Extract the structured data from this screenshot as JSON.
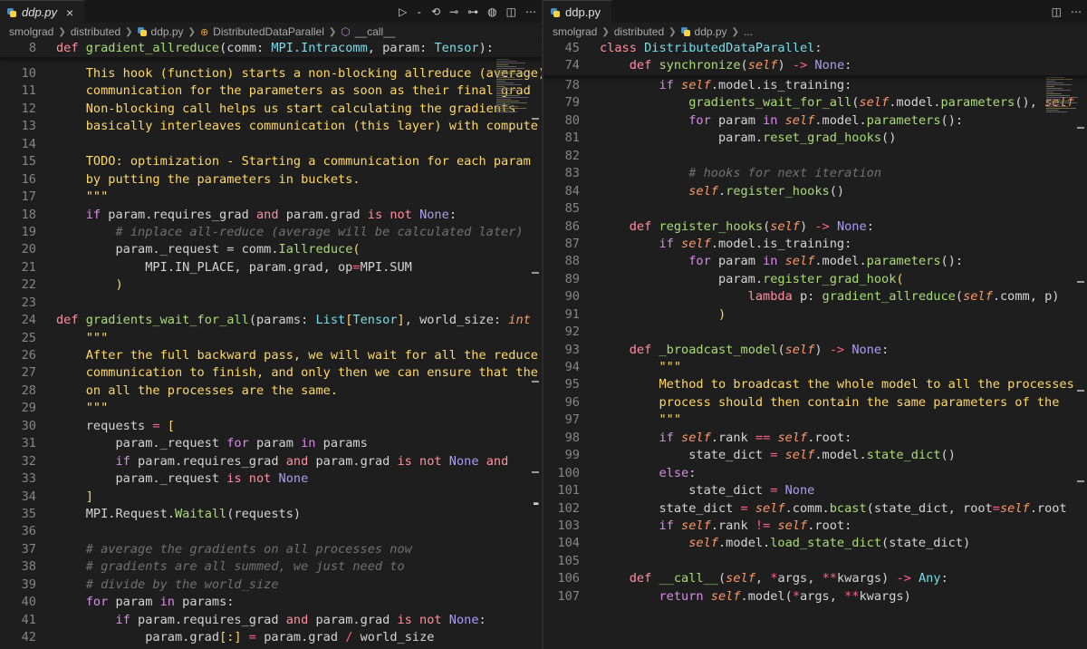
{
  "left": {
    "tab": {
      "title": "ddp.py",
      "close": "×"
    },
    "breadcrumb": [
      "smolgrad",
      "distributed",
      "ddp.py",
      "DistributedDataParallel",
      "__call__"
    ],
    "sticky": [
      {
        "num": "8",
        "tokens": [
          [
            "kw",
            "def "
          ],
          [
            "fn",
            "gradient_allreduce"
          ],
          [
            "",
            "(comm: "
          ],
          [
            "ty",
            "MPI.Intracomm"
          ],
          [
            "",
            ", param: "
          ],
          [
            "ty",
            "Tensor"
          ],
          [
            "",
            "):"
          ]
        ]
      }
    ],
    "lines": [
      {
        "num": "10",
        "tokens": [
          [
            "str",
            "    This hook (function) starts a non-blocking allreduce (average)"
          ]
        ]
      },
      {
        "num": "11",
        "tokens": [
          [
            "str",
            "    communication for the parameters as soon as their final grad"
          ]
        ]
      },
      {
        "num": "12",
        "tokens": [
          [
            "str",
            "    Non-blocking call helps us start calculating the gradients"
          ]
        ]
      },
      {
        "num": "13",
        "tokens": [
          [
            "str",
            "    basically interleaves communication (this layer) with compute"
          ]
        ]
      },
      {
        "num": "14",
        "tokens": []
      },
      {
        "num": "15",
        "tokens": [
          [
            "str",
            "    TODO: optimization - Starting a communication for each param"
          ]
        ]
      },
      {
        "num": "16",
        "tokens": [
          [
            "str",
            "    by putting the parameters in buckets."
          ]
        ]
      },
      {
        "num": "17",
        "tokens": [
          [
            "str",
            "    \"\"\""
          ]
        ]
      },
      {
        "num": "18",
        "tokens": [
          [
            "ctl",
            "    if "
          ],
          [
            "",
            "param.requires_grad "
          ],
          [
            "kw",
            "and "
          ],
          [
            "",
            "param.grad "
          ],
          [
            "kw",
            "is not "
          ],
          [
            "con",
            "None"
          ],
          [
            "",
            ":"
          ]
        ]
      },
      {
        "num": "19",
        "tokens": [
          [
            "com",
            "        # inplace all-reduce (average will be calculated later)"
          ]
        ]
      },
      {
        "num": "20",
        "tokens": [
          [
            "",
            "        param._request = comm."
          ],
          [
            "fn",
            "Iallreduce"
          ],
          [
            "br",
            "("
          ]
        ]
      },
      {
        "num": "21",
        "tokens": [
          [
            "",
            "            MPI.IN_PLACE, param.grad, op"
          ],
          [
            "op",
            "="
          ],
          [
            "",
            "MPI.SUM"
          ]
        ]
      },
      {
        "num": "22",
        "tokens": [
          [
            "br",
            "        )"
          ]
        ]
      },
      {
        "num": "23",
        "tokens": []
      },
      {
        "num": "24",
        "tokens": [
          [
            "kw",
            "def "
          ],
          [
            "fn",
            "gradients_wait_for_all"
          ],
          [
            "",
            "(params: "
          ],
          [
            "ty",
            "List"
          ],
          [
            "br",
            "["
          ],
          [
            "ty",
            "Tensor"
          ],
          [
            "br",
            "]"
          ],
          [
            "",
            ", world_size: "
          ],
          [
            "self",
            "int"
          ]
        ]
      },
      {
        "num": "25",
        "tokens": [
          [
            "str",
            "    \"\"\""
          ]
        ]
      },
      {
        "num": "26",
        "tokens": [
          [
            "str",
            "    After the full backward pass, we will wait for all the reduce"
          ]
        ]
      },
      {
        "num": "27",
        "tokens": [
          [
            "str",
            "    communication to finish, and only then we can ensure that the"
          ]
        ]
      },
      {
        "num": "28",
        "tokens": [
          [
            "str",
            "    on all the processes are the same."
          ]
        ]
      },
      {
        "num": "29",
        "tokens": [
          [
            "str",
            "    \"\"\""
          ]
        ]
      },
      {
        "num": "30",
        "tokens": [
          [
            "",
            "    requests "
          ],
          [
            "op",
            "= "
          ],
          [
            "br",
            "["
          ]
        ]
      },
      {
        "num": "31",
        "tokens": [
          [
            "",
            "        param._request "
          ],
          [
            "ctl",
            "for "
          ],
          [
            "",
            "param "
          ],
          [
            "ctl",
            "in "
          ],
          [
            "",
            "params"
          ]
        ]
      },
      {
        "num": "32",
        "tokens": [
          [
            "ctl",
            "        if "
          ],
          [
            "",
            "param.requires_grad "
          ],
          [
            "kw",
            "and "
          ],
          [
            "",
            "param.grad "
          ],
          [
            "kw",
            "is not "
          ],
          [
            "con",
            "None "
          ],
          [
            "kw",
            "and"
          ]
        ]
      },
      {
        "num": "33",
        "tokens": [
          [
            "",
            "        param._request "
          ],
          [
            "kw",
            "is not "
          ],
          [
            "con",
            "None"
          ]
        ]
      },
      {
        "num": "34",
        "tokens": [
          [
            "br",
            "    ]"
          ]
        ]
      },
      {
        "num": "35",
        "tokens": [
          [
            "",
            "    MPI.Request."
          ],
          [
            "fn",
            "Waitall"
          ],
          [
            "",
            "(requests)"
          ]
        ]
      },
      {
        "num": "36",
        "tokens": []
      },
      {
        "num": "37",
        "tokens": [
          [
            "com",
            "    # average the gradients on all processes now"
          ]
        ]
      },
      {
        "num": "38",
        "tokens": [
          [
            "com",
            "    # gradients are all summed, we just need to"
          ]
        ]
      },
      {
        "num": "39",
        "tokens": [
          [
            "com",
            "    # divide by the world_size"
          ]
        ]
      },
      {
        "num": "40",
        "tokens": [
          [
            "ctl",
            "    for "
          ],
          [
            "",
            "param "
          ],
          [
            "ctl",
            "in "
          ],
          [
            "",
            "params:"
          ]
        ]
      },
      {
        "num": "41",
        "tokens": [
          [
            "ctl",
            "        if "
          ],
          [
            "",
            "param.requires_grad "
          ],
          [
            "kw",
            "and "
          ],
          [
            "",
            "param.grad "
          ],
          [
            "kw",
            "is not "
          ],
          [
            "con",
            "None"
          ],
          [
            "",
            ":"
          ]
        ]
      },
      {
        "num": "42",
        "tokens": [
          [
            "",
            "            param.grad"
          ],
          [
            "br",
            "[:]"
          ],
          [
            "op",
            " = "
          ],
          [
            "",
            "param.grad "
          ],
          [
            "op",
            "/ "
          ],
          [
            "",
            "world_size"
          ]
        ]
      }
    ]
  },
  "right": {
    "tab": {
      "title": "ddp.py"
    },
    "breadcrumb": [
      "smolgrad",
      "distributed",
      "ddp.py",
      "..."
    ],
    "sticky": [
      {
        "num": "45",
        "tokens": [
          [
            "kw",
            "class "
          ],
          [
            "ty",
            "DistributedDataParallel"
          ],
          [
            "",
            ":"
          ]
        ]
      },
      {
        "num": "74",
        "tokens": [
          [
            "kw",
            "    def "
          ],
          [
            "fn",
            "synchronize"
          ],
          [
            "",
            "("
          ],
          [
            "self",
            "self"
          ],
          [
            "",
            ") "
          ],
          [
            "op",
            "-> "
          ],
          [
            "con",
            "None"
          ],
          [
            "",
            ":"
          ]
        ]
      }
    ],
    "lines": [
      {
        "num": "78",
        "tokens": [
          [
            "ctl",
            "        if "
          ],
          [
            "self",
            "self"
          ],
          [
            "",
            ".model.is_training:"
          ]
        ]
      },
      {
        "num": "79",
        "tokens": [
          [
            "fn",
            "            gradients_wait_for_all"
          ],
          [
            "",
            "("
          ],
          [
            "self",
            "self"
          ],
          [
            "",
            ".model."
          ],
          [
            "fn",
            "parameters"
          ],
          [
            "",
            "(), "
          ],
          [
            "self",
            "self"
          ]
        ]
      },
      {
        "num": "80",
        "tokens": [
          [
            "ctl",
            "            for "
          ],
          [
            "",
            "param "
          ],
          [
            "ctl",
            "in "
          ],
          [
            "self",
            "self"
          ],
          [
            "",
            ".model."
          ],
          [
            "fn",
            "parameters"
          ],
          [
            "",
            "():"
          ]
        ]
      },
      {
        "num": "81",
        "tokens": [
          [
            "",
            "                param."
          ],
          [
            "fn",
            "reset_grad_hooks"
          ],
          [
            "",
            "()"
          ]
        ]
      },
      {
        "num": "82",
        "tokens": []
      },
      {
        "num": "83",
        "tokens": [
          [
            "com",
            "            # hooks for next iteration"
          ]
        ]
      },
      {
        "num": "84",
        "tokens": [
          [
            "self",
            "            self"
          ],
          [
            "",
            "."
          ],
          [
            "fn",
            "register_hooks"
          ],
          [
            "",
            "()"
          ]
        ]
      },
      {
        "num": "85",
        "tokens": []
      },
      {
        "num": "86",
        "tokens": [
          [
            "kw",
            "    def "
          ],
          [
            "fn",
            "register_hooks"
          ],
          [
            "",
            "("
          ],
          [
            "self",
            "self"
          ],
          [
            "",
            ") "
          ],
          [
            "op",
            "-> "
          ],
          [
            "con",
            "None"
          ],
          [
            "",
            ":"
          ]
        ]
      },
      {
        "num": "87",
        "tokens": [
          [
            "ctl",
            "        if "
          ],
          [
            "self",
            "self"
          ],
          [
            "",
            ".model.is_training:"
          ]
        ]
      },
      {
        "num": "88",
        "tokens": [
          [
            "ctl",
            "            for "
          ],
          [
            "",
            "param "
          ],
          [
            "ctl",
            "in "
          ],
          [
            "self",
            "self"
          ],
          [
            "",
            ".model."
          ],
          [
            "fn",
            "parameters"
          ],
          [
            "",
            "():"
          ]
        ]
      },
      {
        "num": "89",
        "tokens": [
          [
            "",
            "                param."
          ],
          [
            "fn",
            "register_grad_hook"
          ],
          [
            "br",
            "("
          ]
        ]
      },
      {
        "num": "90",
        "tokens": [
          [
            "kw",
            "                    lambda "
          ],
          [
            "",
            "p: "
          ],
          [
            "fn",
            "gradient_allreduce"
          ],
          [
            "",
            "("
          ],
          [
            "self",
            "self"
          ],
          [
            "",
            ".comm, p)"
          ]
        ]
      },
      {
        "num": "91",
        "tokens": [
          [
            "br",
            "                )"
          ]
        ]
      },
      {
        "num": "92",
        "tokens": []
      },
      {
        "num": "93",
        "tokens": [
          [
            "kw",
            "    def "
          ],
          [
            "fn",
            "_broadcast_model"
          ],
          [
            "",
            "("
          ],
          [
            "self",
            "self"
          ],
          [
            "",
            ") "
          ],
          [
            "op",
            "-> "
          ],
          [
            "con",
            "None"
          ],
          [
            "",
            ":"
          ]
        ]
      },
      {
        "num": "94",
        "tokens": [
          [
            "str",
            "        \"\"\""
          ]
        ]
      },
      {
        "num": "95",
        "tokens": [
          [
            "str",
            "        Method to broadcast the whole model to all the processes"
          ]
        ]
      },
      {
        "num": "96",
        "tokens": [
          [
            "str",
            "        process should then contain the same parameters of the"
          ]
        ]
      },
      {
        "num": "97",
        "tokens": [
          [
            "str",
            "        \"\"\""
          ]
        ]
      },
      {
        "num": "98",
        "tokens": [
          [
            "ctl",
            "        if "
          ],
          [
            "self",
            "self"
          ],
          [
            "",
            ".rank "
          ],
          [
            "op",
            "== "
          ],
          [
            "self",
            "self"
          ],
          [
            "",
            ".root:"
          ]
        ]
      },
      {
        "num": "99",
        "tokens": [
          [
            "",
            "            state_dict "
          ],
          [
            "op",
            "= "
          ],
          [
            "self",
            "self"
          ],
          [
            "",
            ".model."
          ],
          [
            "fn",
            "state_dict"
          ],
          [
            "",
            "()"
          ]
        ]
      },
      {
        "num": "100",
        "tokens": [
          [
            "ctl",
            "        else"
          ],
          [
            "",
            ":"
          ]
        ]
      },
      {
        "num": "101",
        "tokens": [
          [
            "",
            "            state_dict "
          ],
          [
            "op",
            "= "
          ],
          [
            "con",
            "None"
          ]
        ]
      },
      {
        "num": "102",
        "tokens": [
          [
            "",
            "        state_dict "
          ],
          [
            "op",
            "= "
          ],
          [
            "self",
            "self"
          ],
          [
            "",
            ".comm."
          ],
          [
            "fn",
            "bcast"
          ],
          [
            "",
            "(state_dict, root"
          ],
          [
            "op",
            "="
          ],
          [
            "self",
            "self"
          ],
          [
            "",
            ".root"
          ]
        ]
      },
      {
        "num": "103",
        "tokens": [
          [
            "ctl",
            "        if "
          ],
          [
            "self",
            "self"
          ],
          [
            "",
            ".rank "
          ],
          [
            "op",
            "!= "
          ],
          [
            "self",
            "self"
          ],
          [
            "",
            ".root:"
          ]
        ]
      },
      {
        "num": "104",
        "tokens": [
          [
            "self",
            "            self"
          ],
          [
            "",
            ".model."
          ],
          [
            "fn",
            "load_state_dict"
          ],
          [
            "",
            "(state_dict)"
          ]
        ]
      },
      {
        "num": "105",
        "tokens": []
      },
      {
        "num": "106",
        "tokens": [
          [
            "kw",
            "    def "
          ],
          [
            "fn",
            "__call__"
          ],
          [
            "",
            "("
          ],
          [
            "self",
            "self"
          ],
          [
            "",
            ", "
          ],
          [
            "op",
            "*"
          ],
          [
            "",
            "args, "
          ],
          [
            "op",
            "**"
          ],
          [
            "",
            "kwargs) "
          ],
          [
            "op",
            "-> "
          ],
          [
            "ty",
            "Any"
          ],
          [
            "",
            ":"
          ]
        ]
      },
      {
        "num": "107",
        "tokens": [
          [
            "ctl",
            "        return "
          ],
          [
            "self",
            "self"
          ],
          [
            "",
            ".model("
          ],
          [
            "op",
            "*"
          ],
          [
            "",
            "args, "
          ],
          [
            "op",
            "**"
          ],
          [
            "",
            "kwargs)"
          ]
        ]
      }
    ]
  }
}
